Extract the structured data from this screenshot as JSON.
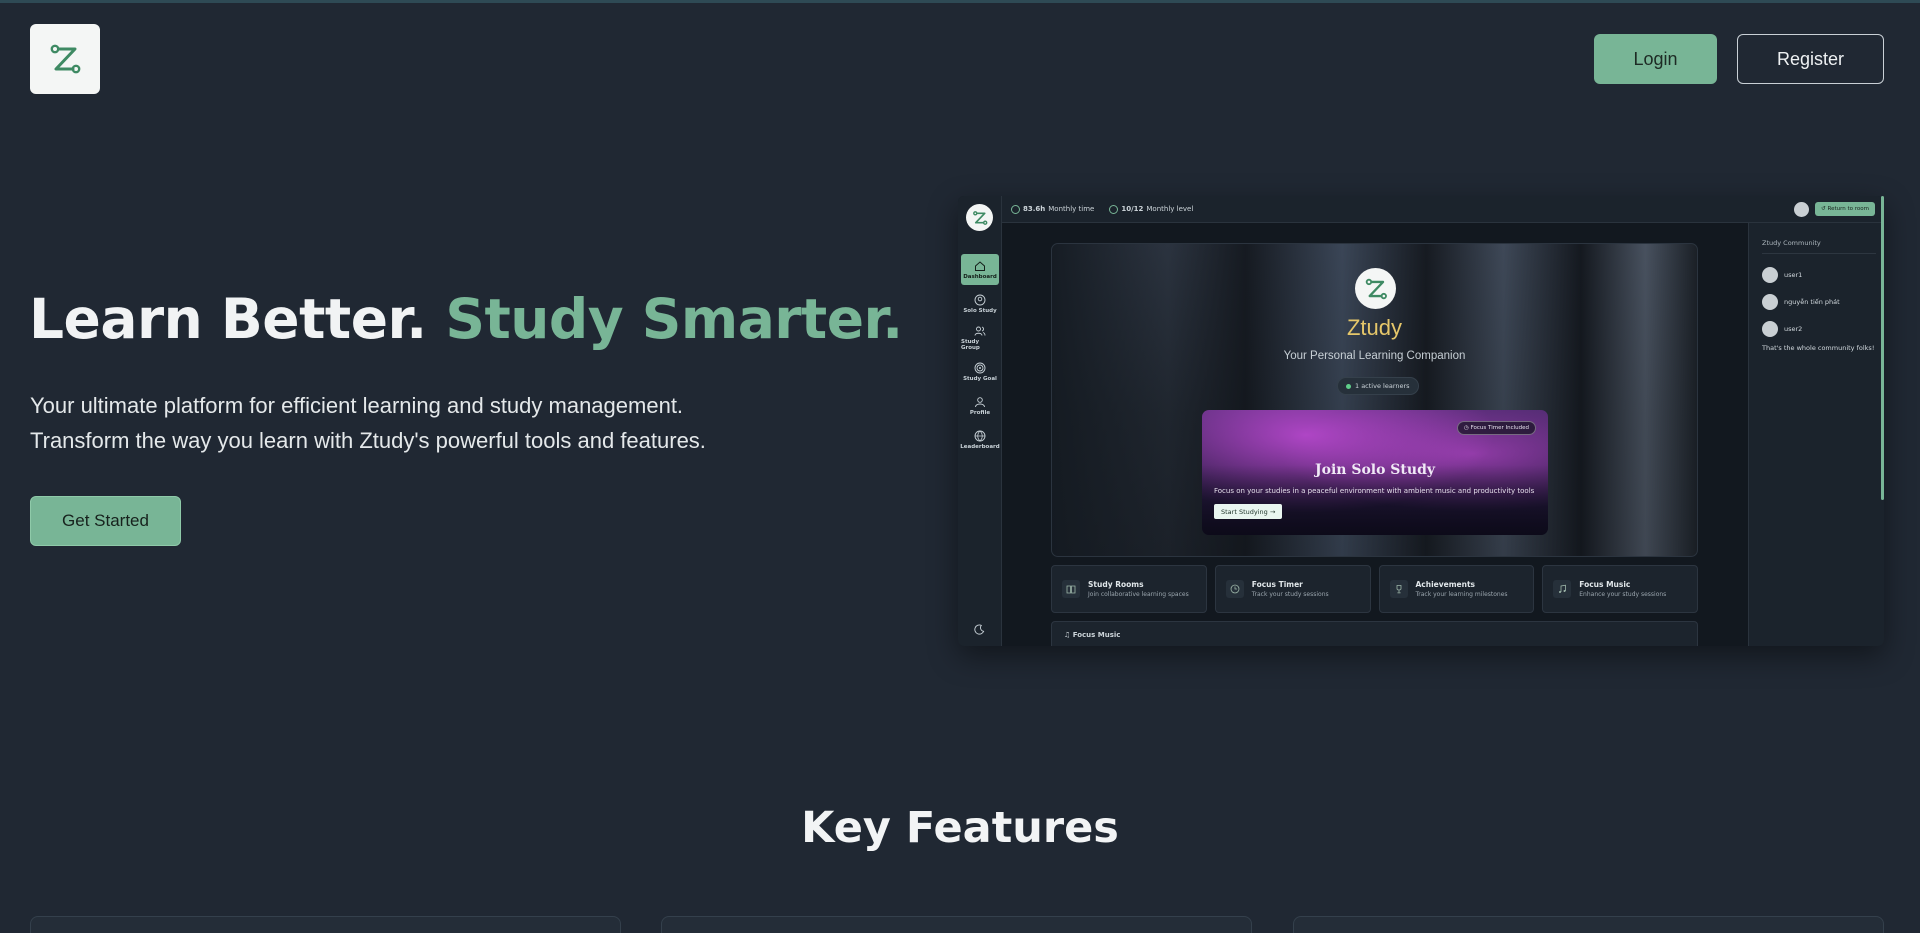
{
  "header": {
    "logo_icon": "ztudy-logo-icon",
    "login_label": "Login",
    "register_label": "Register"
  },
  "hero": {
    "title_main": "Learn Better.",
    "title_accent": "Study Smarter.",
    "subtitle_line1": "Your ultimate platform for efficient learning and study management.",
    "subtitle_line2": "Transform the way you learn with Ztudy's powerful tools and features.",
    "cta_label": "Get Started"
  },
  "preview": {
    "sidebar": [
      {
        "label": "Dashboard",
        "icon": "home-icon",
        "active": true
      },
      {
        "label": "Solo Study",
        "icon": "user-circle-icon",
        "active": false
      },
      {
        "label": "Study Group",
        "icon": "users-icon",
        "active": false
      },
      {
        "label": "Study Goal",
        "icon": "target-icon",
        "active": false
      },
      {
        "label": "Profile",
        "icon": "person-icon",
        "active": false
      },
      {
        "label": "Leaderboard",
        "icon": "globe-icon",
        "active": false
      }
    ],
    "topbar": {
      "monthly_time_value": "83.6h",
      "monthly_time_label": "Monthly time",
      "monthly_level_value": "10/12",
      "monthly_level_label": "Monthly level",
      "return_label": "Return to room"
    },
    "hero_card": {
      "brand": "Ztudy",
      "tagline": "Your Personal Learning Companion",
      "active_learners": "1 active learners"
    },
    "solo_card": {
      "badge": "Focus Timer Included",
      "title": "Join Solo Study",
      "description": "Focus on your studies in a peaceful environment with ambient music and productivity tools",
      "button": "Start Studying →"
    },
    "features": [
      {
        "title": "Study Rooms",
        "desc": "Join collaborative learning spaces",
        "icon": "book-icon"
      },
      {
        "title": "Focus Timer",
        "desc": "Track your study sessions",
        "icon": "clock-icon"
      },
      {
        "title": "Achievements",
        "desc": "Track your learning milestones",
        "icon": "trophy-icon"
      },
      {
        "title": "Focus Music",
        "desc": "Enhance your study sessions",
        "icon": "music-icon"
      }
    ],
    "focus_strip_label": "Focus Music",
    "community": {
      "title": "Ztudy Community",
      "users": [
        "user1",
        "nguyễn tiến phát",
        "user2"
      ],
      "note": "That's the whole community folks!"
    }
  },
  "key_features": {
    "title": "Key Features"
  },
  "colors": {
    "background": "#202833",
    "accent": "#78b596",
    "brand_gold": "#e6c76a"
  }
}
